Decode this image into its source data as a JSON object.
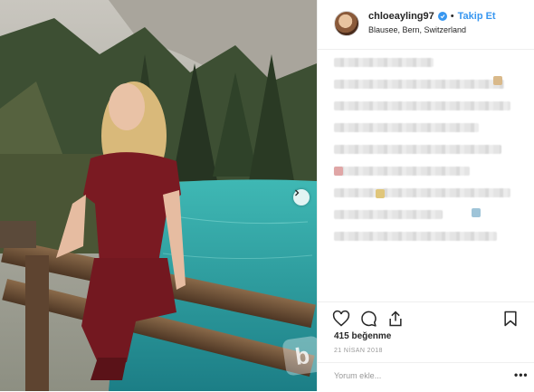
{
  "header": {
    "username": "chloeayling97",
    "separator": "•",
    "follow_label": "Takip Et",
    "location": "Blausee, Bern, Switzerland"
  },
  "caption": {
    "blurred": true
  },
  "actions": {
    "like_icon": "heart-icon",
    "comment_icon": "comment-icon",
    "share_icon": "share-icon",
    "save_icon": "bookmark-icon"
  },
  "likes_text": "415 beğenme",
  "date_text": "21 NİSAN 2018",
  "comment": {
    "placeholder": "Yorum ekle...",
    "more_label": "•••"
  },
  "watermark_letter": "b",
  "colors": {
    "link_blue": "#3897f0",
    "text": "#262626",
    "muted": "#999999",
    "border": "#efefef"
  }
}
